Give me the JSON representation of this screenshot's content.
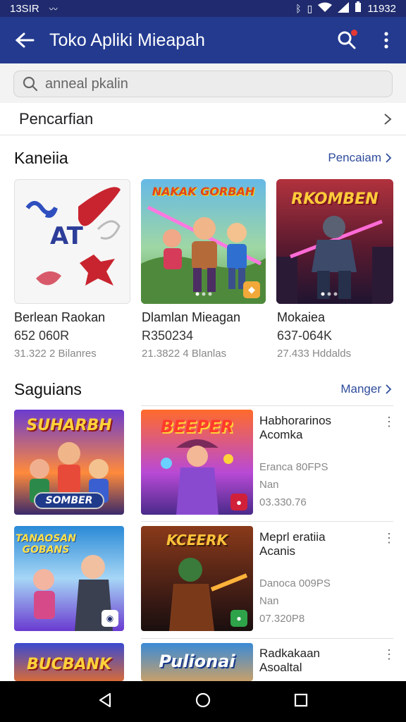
{
  "status": {
    "time_left": "13SIR",
    "time_right": "11932",
    "net": "ᴺᴳ"
  },
  "appbar": {
    "title": "Toko Apliki Mieapah"
  },
  "search": {
    "placeholder": "anneal pkalin"
  },
  "history_row": {
    "label": "Pencarfian"
  },
  "section1": {
    "title": "Kaneiia",
    "more": "Pencaiam",
    "cards": [
      {
        "name": "Berlean Raokan",
        "price": "652 060R",
        "downloads": "31.322 2 Bilanres",
        "logo": "AT"
      },
      {
        "name": "Dlamlan Mieagan",
        "price": "R350234",
        "downloads": "21.3822 4 Blanlas",
        "logo": "NAKAK GORBAH"
      },
      {
        "name": "Mokaiea",
        "price": "637-064K",
        "downloads": "27.433 Hddalds",
        "logo": "RKOMBEN"
      }
    ]
  },
  "section2": {
    "title": "Saguians",
    "more": "Manger",
    "items": [
      {
        "logo_left": "SUHARBH",
        "badge_left": "SOMBER",
        "logo_right": "BEEPER",
        "name": "Habhorarinos",
        "sub": "Acomka",
        "meta": "Eranca 80FPS",
        "size": "Nan",
        "count": "03.330.76"
      },
      {
        "logo_left": "TANAOSAN GOBANS",
        "logo_right": "KCEERK",
        "name": "Meprl eratiia",
        "sub": "Acanis",
        "meta": "Danoca 009PS",
        "size": "Nan",
        "count": "07.320P8"
      },
      {
        "logo_left": "BUCBANK",
        "logo_right": "Pulionai",
        "name": "Radkakaan",
        "sub": "Asoaltal"
      }
    ]
  },
  "colors": {
    "appbar": "#233a8f",
    "statusbar": "#1f2b6e",
    "accent": "#2f4c9c",
    "nav": "#000000"
  }
}
